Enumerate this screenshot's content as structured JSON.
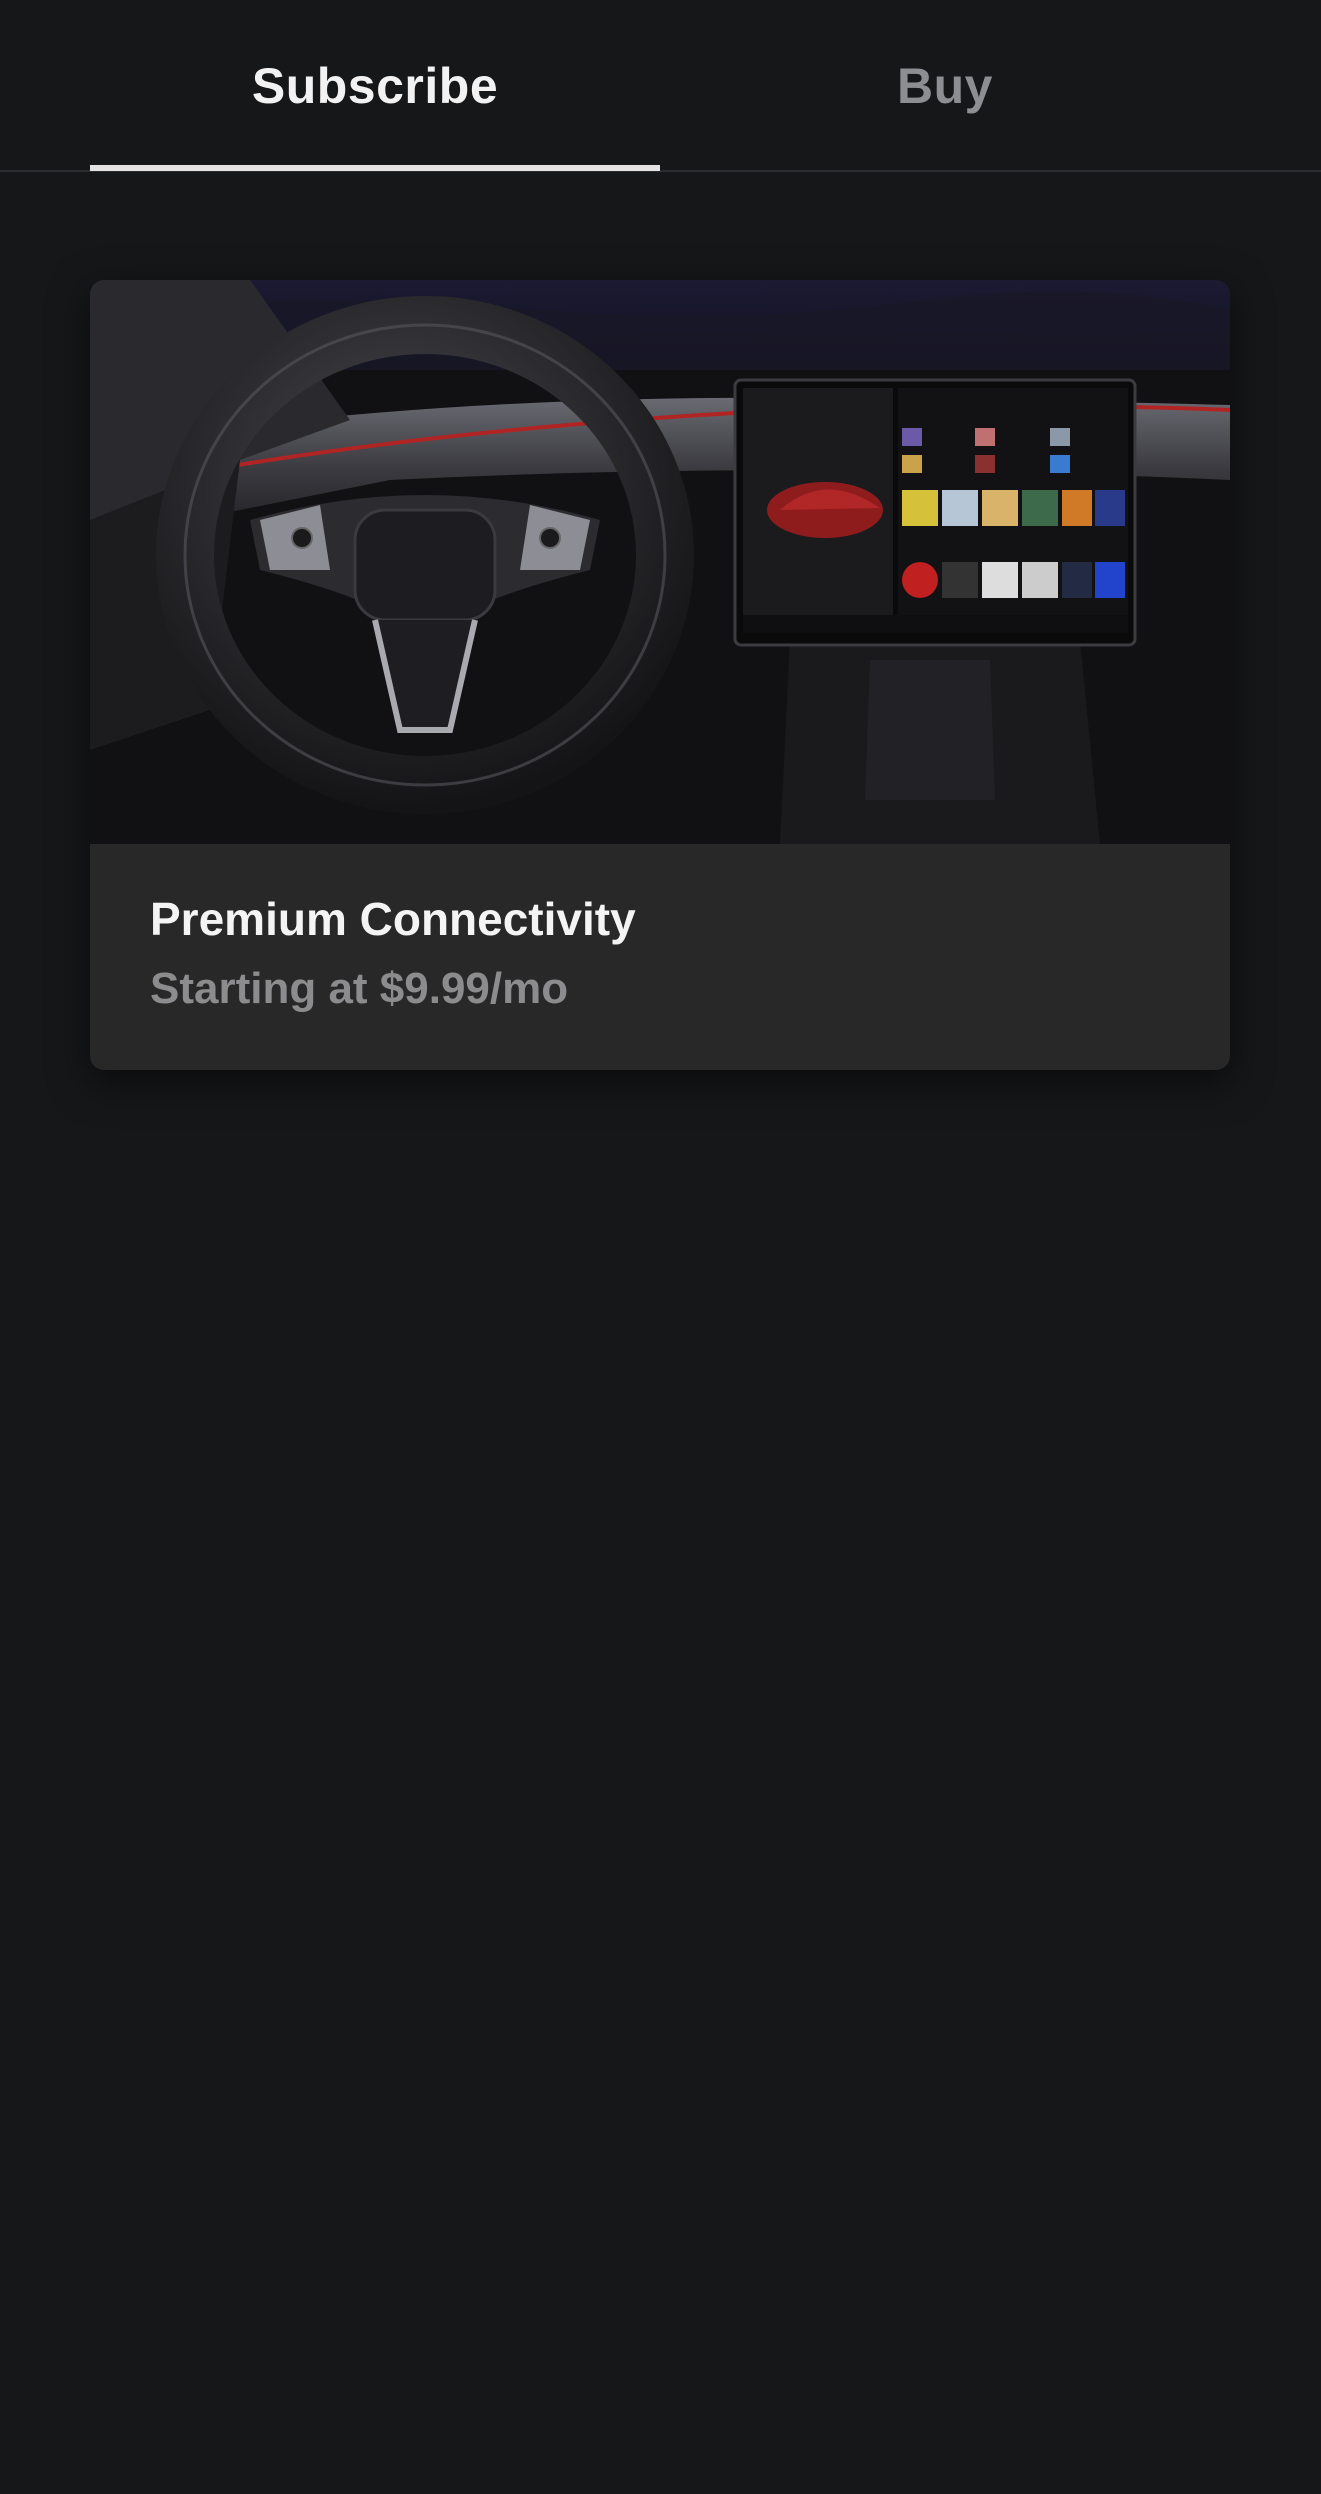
{
  "tabs": {
    "subscribe_label": "Subscribe",
    "buy_label": "Buy",
    "active": "Subscribe"
  },
  "card": {
    "title": "Premium Connectivity",
    "subtitle": "Starting at $9.99/mo",
    "image": "car-interior-touchscreen-image"
  },
  "colors": {
    "background": "#161719",
    "card_background": "#282829",
    "active_tab_text": "#f2f2f2",
    "inactive_tab_text": "#8d8e92",
    "subtitle_text": "#8c8c8e"
  }
}
